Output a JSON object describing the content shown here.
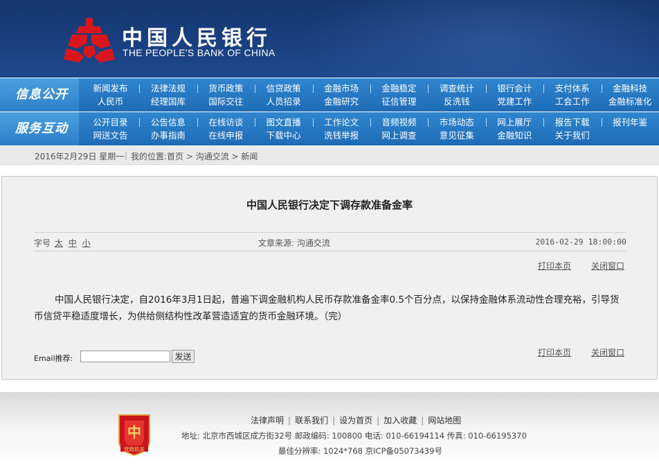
{
  "header": {
    "bank_cn": "中国人民银行",
    "bank_en": "THE PEOPLE'S BANK OF CHINA",
    "brand_red": "#d8171d",
    "brand_blue": "#1a4080"
  },
  "nav": {
    "row1": {
      "label": "信息公开",
      "items": [
        [
          "新闻发布",
          "人民币"
        ],
        [
          "法律法规",
          "经理国库"
        ],
        [
          "货币政策",
          "国际交往"
        ],
        [
          "信贷政策",
          "人员招录"
        ],
        [
          "金融市场",
          "金融研究"
        ],
        [
          "金融稳定",
          "征信管理"
        ],
        [
          "调查统计",
          "反洗钱"
        ],
        [
          "银行会计",
          "党建工作"
        ],
        [
          "支付体系",
          "工会工作"
        ],
        [
          "金融科技",
          "金融标准化"
        ]
      ]
    },
    "row2": {
      "label": "服务互动",
      "items": [
        [
          "公开目录",
          "网送文告"
        ],
        [
          "公告信息",
          "办事指南"
        ],
        [
          "在线访谈",
          "在线申报"
        ],
        [
          "图文直播",
          "下载中心"
        ],
        [
          "工作论文",
          "洗钱举报"
        ],
        [
          "音频视频",
          "网上调查"
        ],
        [
          "市场动态",
          "意见征集"
        ],
        [
          "网上展厅",
          "金融知识"
        ],
        [
          "报告下载",
          "关于我们"
        ],
        [
          "报刊年鉴",
          ""
        ]
      ]
    }
  },
  "crumb": {
    "date": "2016年2月29日 星期一",
    "location": "我的位置:首页 > 沟通交流 > 新闻"
  },
  "article": {
    "title": "中国人民银行决定下调存款准备金率",
    "font_label": "字号",
    "font_large": "太",
    "font_medium": "中",
    "font_small": "小",
    "source": "文章来源: 沟通交流",
    "datetime": "2016-02-29 18:00:00",
    "print": "打印本页",
    "close": "关闭窗口",
    "body": "中国人民银行决定，自2016年3月1日起，普遍下调金融机构人民币存款准备金率0.5个百分点，以保持金融体系流动性合理充裕，引导货币信贷平稳适度增长，为供给侧结构性改革营造适宜的货币金融环境。（完）",
    "email_label": "Email推荐:",
    "email_value": "",
    "send": "发送"
  },
  "footer": {
    "badge_text": "党政机关",
    "links": [
      "法律声明",
      "联系我们",
      "设为首页",
      "加入收藏",
      "网站地图"
    ],
    "address": "地址: 北京市西城区成方街32号   邮政编码: 100800   电话: 010-66194114   传真: 010-66195370",
    "resolution": "最佳分辨率: 1024*768   京ICP备05073439号"
  }
}
